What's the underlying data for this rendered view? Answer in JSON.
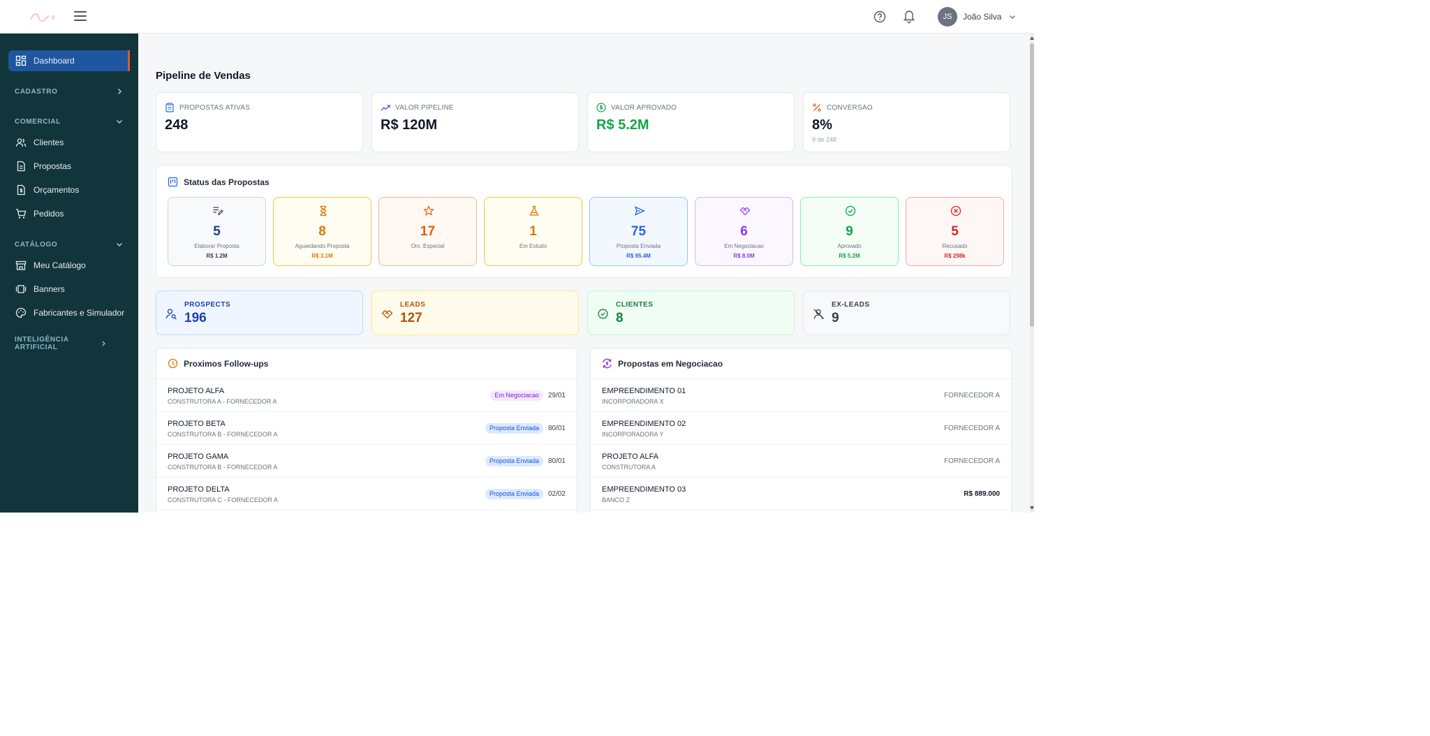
{
  "header": {
    "user_initials": "JS",
    "user_name": "João Silva"
  },
  "sidebar": {
    "dashboard": "Dashboard",
    "sections": {
      "cadastro": "CADASTRO",
      "comercial": "COMERCIAL",
      "catalogo": "CATÁLOGO",
      "ia": "INTELIGÊNCIA ARTIFICIAL"
    },
    "comercial_items": [
      "Clientes",
      "Propostas",
      "Orçamentos",
      "Pedidos"
    ],
    "catalogo_items": [
      "Meu Catálogo",
      "Banners",
      "Fabricantes e Simulador"
    ],
    "active_color": "#1e56a0",
    "accent": "#e0582b"
  },
  "page": {
    "title": "Pipeline de Vendas"
  },
  "kpis": [
    {
      "label": "PROPOSTAS ATIVAS",
      "value": "248",
      "icon": "clipboard-icon",
      "sub": ""
    },
    {
      "label": "VALOR PIPELINE",
      "value": "R$ 120M",
      "icon": "trending-up-icon",
      "sub": ""
    },
    {
      "label": "VALOR APROVADO",
      "value": "R$ 5.2M",
      "icon": "dollar-circle-icon",
      "sub": ""
    },
    {
      "label": "CONVERSAO",
      "value": "8%",
      "icon": "percent-icon",
      "sub": "9 de 248"
    }
  ],
  "status": {
    "title": "Status das Propostas",
    "cards": [
      {
        "count": "5",
        "label": "Elaborar Proposta",
        "amount": "R$ 1.2M",
        "icon": "edit-list-icon",
        "color": "#2563eb"
      },
      {
        "count": "8",
        "label": "Aguardando Proposta",
        "amount": "R$ 3.1M",
        "icon": "hourglass-icon",
        "color": "#d97706"
      },
      {
        "count": "17",
        "label": "Orc. Especial",
        "amount": "",
        "icon": "star-icon",
        "color": "#ea580c"
      },
      {
        "count": "1",
        "label": "Em Estudo",
        "amount": "",
        "icon": "flask-icon",
        "color": "#d97706"
      },
      {
        "count": "75",
        "label": "Proposta Enviada",
        "amount": "R$ 95.4M",
        "icon": "send-icon",
        "color": "#2563eb"
      },
      {
        "count": "6",
        "label": "Em Negociacao",
        "amount": "R$ 8.0M",
        "icon": "handshake-icon",
        "color": "#9333ea"
      },
      {
        "count": "9",
        "label": "Aprovado",
        "amount": "R$ 5.2M",
        "icon": "check-circle-icon",
        "color": "#16a34a"
      },
      {
        "count": "5",
        "label": "Recusado",
        "amount": "R$ 298k",
        "icon": "x-circle-icon",
        "color": "#dc2626"
      }
    ]
  },
  "segments": [
    {
      "label": "PROSPECTS",
      "value": "196",
      "icon": "user-search-icon"
    },
    {
      "label": "LEADS",
      "value": "127",
      "icon": "handshake-icon"
    },
    {
      "label": "CLIENTES",
      "value": "8",
      "icon": "badge-check-icon"
    },
    {
      "label": "EX-LEADS",
      "value": "9",
      "icon": "user-off-icon"
    }
  ],
  "followups": {
    "title": "Proximos Follow-ups",
    "rows": [
      {
        "title": "PROJETO ALFA",
        "sub": "CONSTRUTORA A - FORNECEDOR A",
        "badge": "Em Negociacao",
        "date": "29/01"
      },
      {
        "title": "PROJETO BETA",
        "sub": "CONSTRUTORA B - FORNECEDOR A",
        "badge": "Proposta Enviada",
        "date": "80/01"
      },
      {
        "title": "PROJETO GAMA",
        "sub": "CONSTRUTORA B - FORNECEDOR A",
        "badge": "Proposta Enviada",
        "date": "80/01"
      },
      {
        "title": "PROJETO DELTA",
        "sub": "CONSTRUTORA C - FORNECEDOR A",
        "badge": "Proposta Enviada",
        "date": "02/02"
      }
    ]
  },
  "negociacao": {
    "title": "Propostas em Negociacao",
    "rows": [
      {
        "title": "EMPREENDIMENTO 01",
        "sub": "INCORPORADORA X",
        "right": "FORNECEDOR A"
      },
      {
        "title": "EMPREENDIMENTO 02",
        "sub": "INCORPORADORA Y",
        "right": "FORNECEDOR A"
      },
      {
        "title": "PROJETO ALFA",
        "sub": "CONSTRUTORA A",
        "right": "FORNECEDOR A"
      },
      {
        "title": "EMPREENDIMENTO 03",
        "sub": "BANCO Z",
        "right": "R$ 889.000"
      }
    ]
  }
}
